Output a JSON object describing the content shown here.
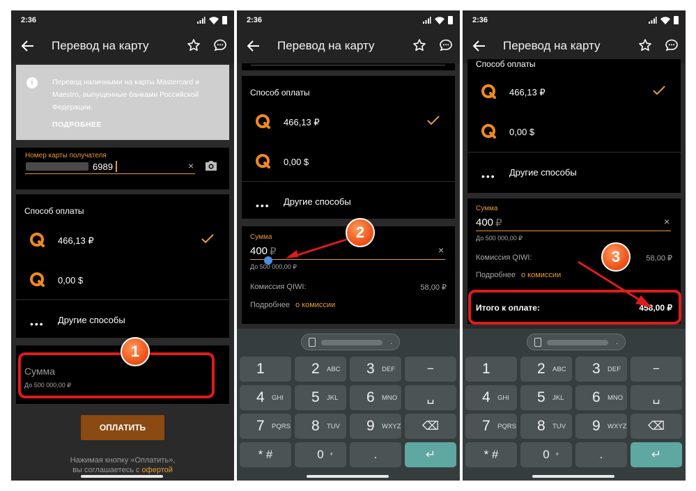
{
  "status": {
    "time": "2:36"
  },
  "appbar": {
    "title": "Перевод на карту"
  },
  "info": {
    "text": "Перевод наличными на карты Mastercard и Maestro, выпущенные банками Российской Федерации.",
    "more": "ПОДРОБНЕЕ"
  },
  "card_field": {
    "label": "Номер карты получателя",
    "value_suffix": "6989"
  },
  "payment": {
    "title": "Способ оплаты",
    "options": [
      {
        "amount": "466,13 ₽",
        "selected": true
      },
      {
        "amount": "0,00 $",
        "selected": false
      }
    ],
    "other": "Другие способы"
  },
  "sum": {
    "placeholder": "Сумма",
    "label": "Сумма",
    "limit": "До 500 000,00 ₽",
    "value": "400",
    "currency": "₽"
  },
  "commission": {
    "label": "Комиссия QIWI:",
    "value": "58,00 ₽",
    "more_prefix": "Подробнее",
    "more_link": "о комиссии"
  },
  "total": {
    "label": "Итого к оплате:",
    "value": "458,00 ₽"
  },
  "pay_button": "ОПЛАТИТЬ",
  "disclaimer": {
    "line1": "Нажимая кнопку «Оплатить»,",
    "line2_prefix": "вы соглашаетесь с",
    "line2_link": "офертой"
  },
  "keyboard": {
    "keys": [
      {
        "n": "1",
        "s": ""
      },
      {
        "n": "2",
        "s": "ABC"
      },
      {
        "n": "3",
        "s": "DEF"
      },
      {
        "n": "−",
        "s": ""
      },
      {
        "n": "4",
        "s": "GHI"
      },
      {
        "n": "5",
        "s": "JKL"
      },
      {
        "n": "6",
        "s": "MNO"
      },
      {
        "n": "␣",
        "s": ""
      },
      {
        "n": "7",
        "s": "PQRS"
      },
      {
        "n": "8",
        "s": "TUV"
      },
      {
        "n": "9",
        "s": "WXYZ"
      },
      {
        "n": "⌫",
        "s": ""
      },
      {
        "n": "* #",
        "s": ""
      },
      {
        "n": "0",
        "s": "+"
      },
      {
        "n": ".",
        "s": ""
      },
      {
        "n": "↵",
        "s": ""
      }
    ],
    "clip_dot": "."
  },
  "annotations": {
    "badge1": "1",
    "badge2": "2",
    "badge3": "3"
  },
  "colors": {
    "accent": "#e89b3c",
    "annotation_red": "#e01b1b",
    "badge_orange": "#f0561c",
    "enter_key": "#5fa7a1",
    "pay_button": "#8a4a12"
  }
}
